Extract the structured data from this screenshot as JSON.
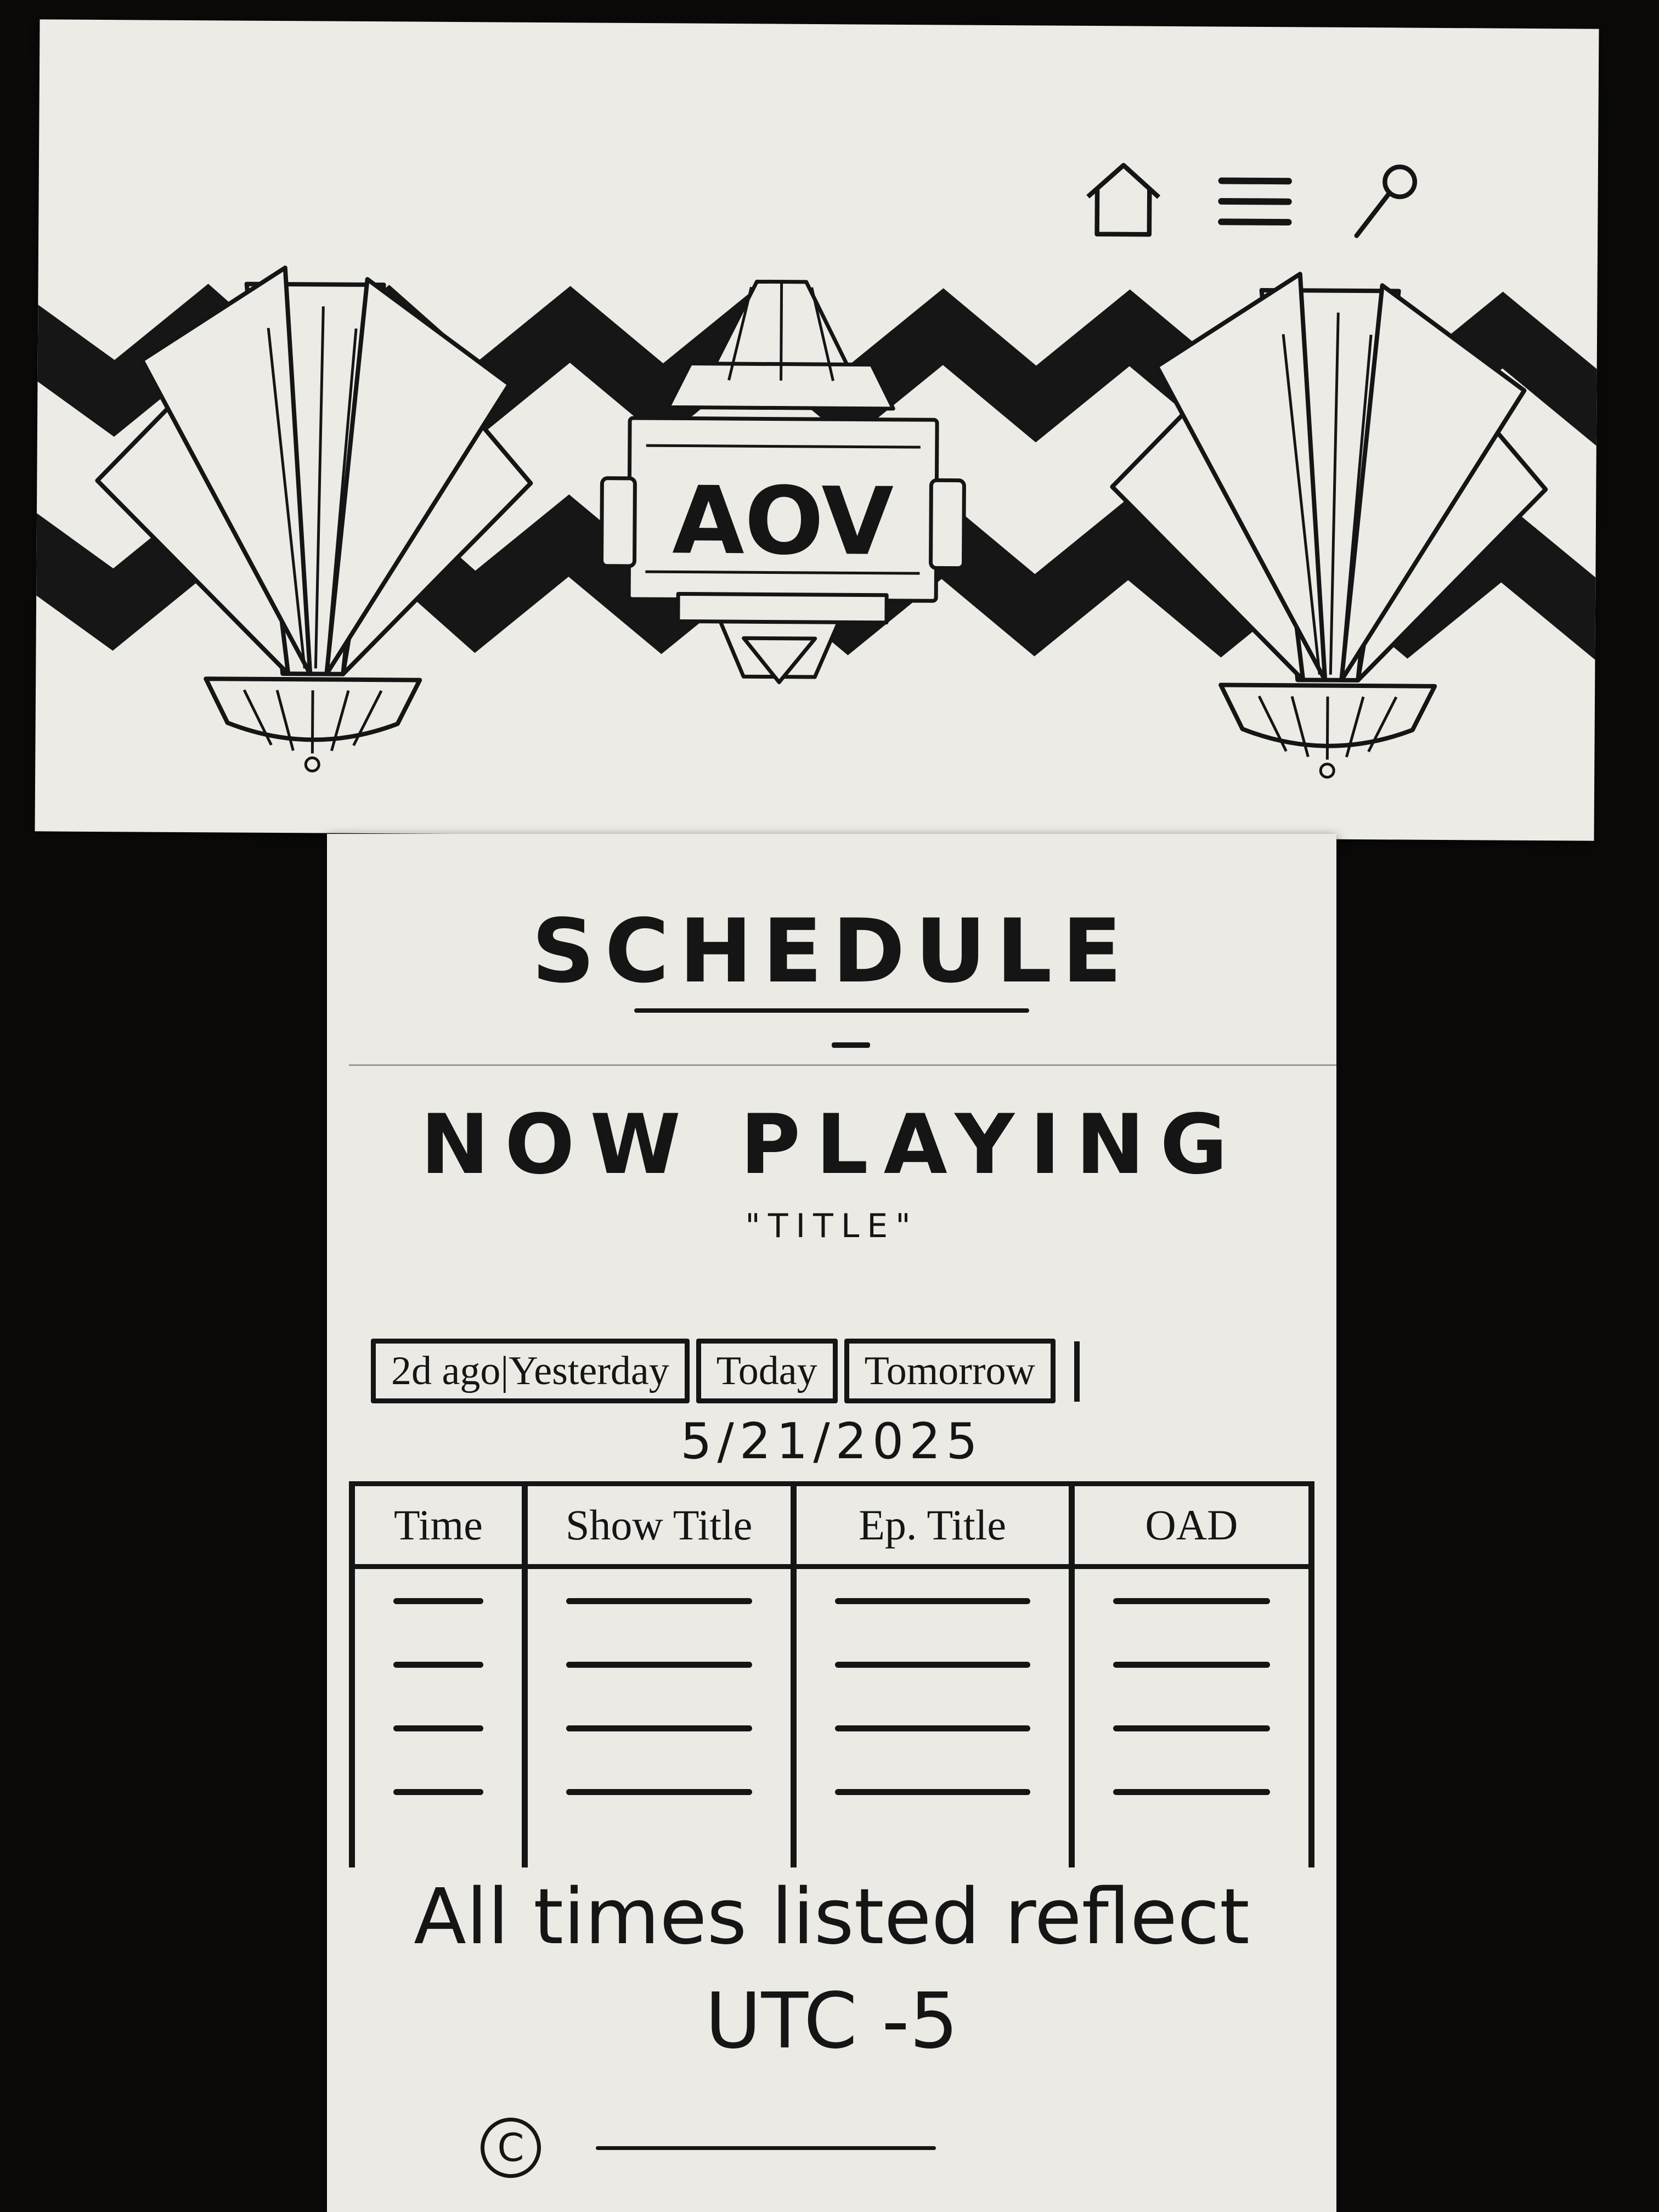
{
  "header": {
    "logo_text": "AOV",
    "nav": [
      {
        "icon": "home-icon"
      },
      {
        "icon": "menu-icon"
      },
      {
        "icon": "search-icon"
      }
    ]
  },
  "page": {
    "heading": "SCHEDULE",
    "now_playing_label": "NOW PLAYING",
    "now_playing_title": "\"TITLE\""
  },
  "tabs": [
    {
      "label": "2d ago"
    },
    {
      "label": "Yesterday"
    },
    {
      "label": "Today"
    },
    {
      "label": "Tomorrow"
    }
  ],
  "date": "5/21/2025",
  "table": {
    "columns": [
      "Time",
      "Show Title",
      "Ep. Title",
      "OAD"
    ],
    "placeholder_rows": 4
  },
  "footer": {
    "timezone_line1": "All times listed reflect",
    "timezone_line2": "UTC -5",
    "copyright_symbol": "C"
  },
  "colors": {
    "paper": "#ecebe6",
    "ink": "#151515",
    "background": "#0b0a09"
  }
}
